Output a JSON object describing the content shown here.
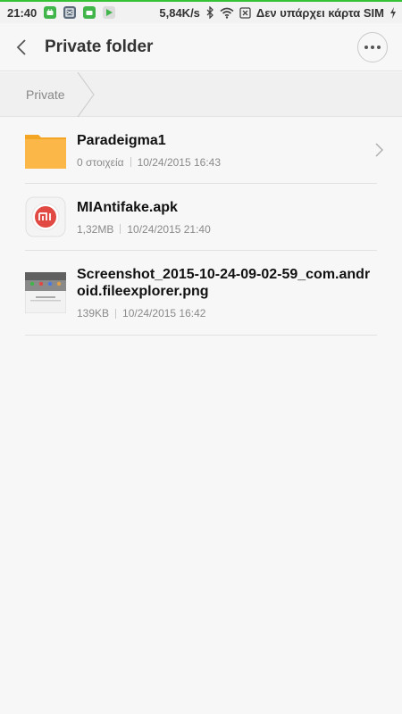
{
  "status_bar": {
    "time": "21:40",
    "network_speed": "5,84K/s",
    "carrier": "Δεν υπάρχει κάρτα SIM",
    "icons": [
      "android-notification-icon",
      "bluetooth-icon",
      "wifi-icon",
      "no-sim-icon",
      "charging-icon"
    ]
  },
  "header": {
    "title": "Private folder",
    "back_icon": "chevron-left-icon",
    "more_icon": "more-horizontal-icon"
  },
  "breadcrumb": {
    "items": [
      "Private"
    ]
  },
  "files": [
    {
      "name": "Paradeigma1",
      "icon": "folder-icon",
      "meta_left": "0 στοιχεία",
      "meta_right": "10/24/2015 16:43",
      "has_chevron": true
    },
    {
      "name": "MIAntifake.apk",
      "icon": "mi-app-icon",
      "meta_left": "1,32MB",
      "meta_right": "10/24/2015 21:40",
      "has_chevron": false
    },
    {
      "name": "Screenshot_2015-10-24-09-02-59_com.android.fileexplorer.png",
      "icon": "image-thumbnail-icon",
      "meta_left": "139KB",
      "meta_right": "10/24/2015 16:42",
      "has_chevron": false
    }
  ],
  "colors": {
    "folder": "#fbb848",
    "mi_red": "#e04a43",
    "status_accent": "#35c235"
  }
}
